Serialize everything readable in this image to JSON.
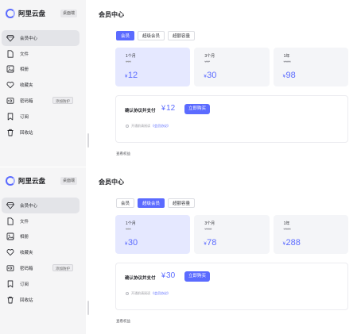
{
  "panels": [
    {
      "brand": {
        "name": "阿里云盘",
        "desktop_button": "桌面端"
      },
      "nav": [
        {
          "label": "会员中心",
          "icon": "diamond-icon"
        },
        {
          "label": "文件",
          "icon": "file-icon"
        },
        {
          "label": "相册",
          "icon": "photo-icon"
        },
        {
          "label": "收藏夹",
          "icon": "heart-icon"
        },
        {
          "label": "密码箱",
          "icon": "safe-icon",
          "tag": "添加防护"
        },
        {
          "label": "订阅",
          "icon": "bookmark-icon"
        },
        {
          "label": "回收站",
          "icon": "trash-icon"
        }
      ],
      "main": {
        "title": "会员中心",
        "tabs": [
          {
            "label": "会员",
            "active": true
          },
          {
            "label": "超级会员",
            "active": false
          },
          {
            "label": "超额容量",
            "active": false
          }
        ],
        "plans": [
          {
            "name": "1个月",
            "original": "¥15",
            "currency": "¥",
            "price": "12",
            "selected": true
          },
          {
            "name": "3个月",
            "original": "¥37",
            "currency": "¥",
            "price": "30",
            "selected": false
          },
          {
            "name": "1年",
            "original": "¥128",
            "currency": "¥",
            "price": "98",
            "selected": false
          }
        ],
        "pay": {
          "label": "确认协议并支付",
          "currency": "¥",
          "amount": "12",
          "button": "立即购买"
        },
        "agreement": {
          "text": "开通前请阅读",
          "link": "《会员协议》"
        },
        "benefits": "查看权益"
      }
    },
    {
      "brand": {
        "name": "阿里云盘",
        "desktop_button": "桌面端"
      },
      "nav": [
        {
          "label": "会员中心",
          "icon": "diamond-icon"
        },
        {
          "label": "文件",
          "icon": "file-icon"
        },
        {
          "label": "相册",
          "icon": "photo-icon"
        },
        {
          "label": "收藏夹",
          "icon": "heart-icon"
        },
        {
          "label": "密码箱",
          "icon": "safe-icon",
          "tag": "添加防护"
        },
        {
          "label": "订阅",
          "icon": "bookmark-icon"
        },
        {
          "label": "回收站",
          "icon": "trash-icon"
        }
      ],
      "main": {
        "title": "会员中心",
        "tabs": [
          {
            "label": "会员",
            "active": false
          },
          {
            "label": "超级会员",
            "active": true
          },
          {
            "label": "超额容量",
            "active": false
          }
        ],
        "plans": [
          {
            "name": "1个月",
            "original": "¥60",
            "currency": "¥",
            "price": "30",
            "selected": true
          },
          {
            "name": "3个月",
            "original": "¥168",
            "currency": "¥",
            "price": "78",
            "selected": false
          },
          {
            "name": "1年",
            "original": "¥588",
            "currency": "¥",
            "price": "288",
            "selected": false
          }
        ],
        "pay": {
          "label": "确认协议并支付",
          "currency": "¥",
          "amount": "30",
          "button": "立即购买"
        },
        "agreement": {
          "text": "开通前请阅读",
          "link": "《会员协议》"
        },
        "benefits": "查看权益"
      }
    }
  ],
  "colors": {
    "accent": "#5b6bff",
    "selected_plan": "#e5e8ff",
    "sidebar": "#f5f5f6"
  }
}
